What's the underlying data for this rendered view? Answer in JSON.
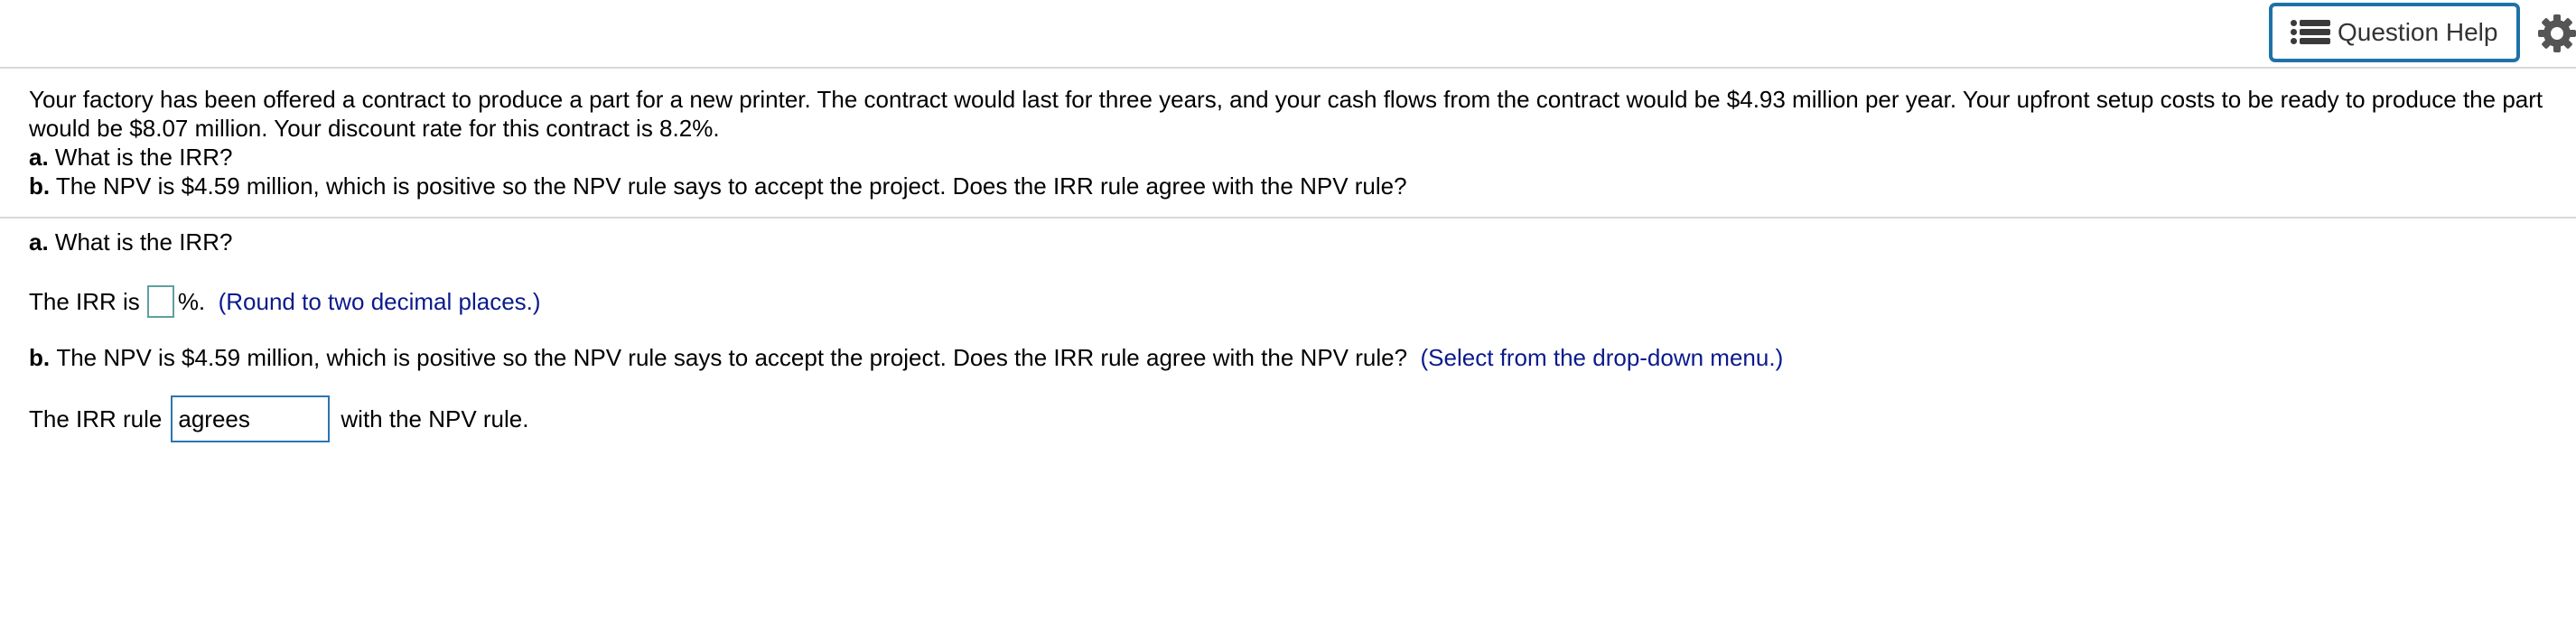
{
  "toolbar": {
    "help_button_label": "Question Help",
    "help_icon": "list-icon",
    "settings_icon": "gear-icon"
  },
  "question": {
    "paragraph": "Your factory has been offered a contract to produce a part for a new printer. The contract would last for three years, and your cash flows from the contract would be $4.93 million per year. Your upfront setup costs to be ready to produce the part would be $8.07 million. Your discount rate for this contract is 8.2%.",
    "part_a_prefix": "a.",
    "part_a_text": "What is the IRR?",
    "part_b_prefix": "b.",
    "part_b_text": "The NPV is $4.59 million, which is positive so the NPV rule says to accept the project. Does the IRR rule agree with the NPV rule?"
  },
  "answer": {
    "part_a_prefix": "a.",
    "part_a_text": "What is the IRR?",
    "irr_label": "The IRR is",
    "irr_value": "",
    "irr_suffix": "%.",
    "irr_hint": "(Round to two decimal places.)",
    "part_b_prefix": "b.",
    "part_b_text": "The NPV is $4.59 million, which is positive so the NPV rule says to accept the project. Does the IRR rule agree with the NPV rule?",
    "part_b_hint": "(Select from the drop-down menu.)",
    "rule_label": "The IRR rule",
    "rule_selected": "agrees",
    "rule_suffix": "with the NPV rule."
  },
  "colors": {
    "accent_border": "#1f71a8",
    "hint_text": "#0a1a8c",
    "divider": "#d9d9d9"
  }
}
